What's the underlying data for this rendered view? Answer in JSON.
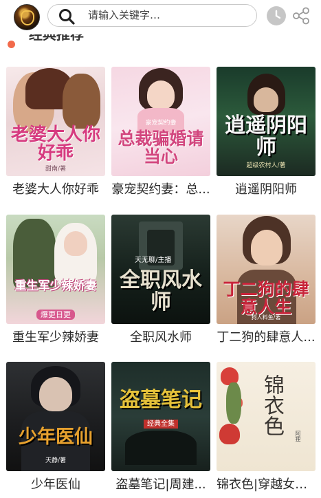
{
  "header": {
    "search_placeholder": "请输入关键字…"
  },
  "section": {
    "title": "经典推荐"
  },
  "books": [
    {
      "name": "老婆大人你好乖",
      "cover_text": "老婆大人你好乖",
      "cover_sub": "甜南/著"
    },
    {
      "name": "豪宠契约妻：总...",
      "cover_text": "总裁骗婚请当心",
      "cover_sub": "豪宠契约妻"
    },
    {
      "name": "逍遥阴阳师",
      "cover_text": "逍遥阴阳师",
      "cover_sub": "超级农村人/著"
    },
    {
      "name": "重生军少辣娇妻",
      "cover_text": "重生军少辣娇妻",
      "cover_sub": "爆更日更"
    },
    {
      "name": "全职风水师",
      "cover_text": "全职风水师",
      "cover_sub": "天无聊/主播"
    },
    {
      "name": "丁二狗的肆意人...",
      "cover_text": "丁二狗的肆意人生",
      "cover_sub": "狗人料鱼/著"
    },
    {
      "name": "少年医仙",
      "cover_text": "少年医仙",
      "cover_sub": "天静/著"
    },
    {
      "name": "盗墓笔记|周建...",
      "cover_text": "盗墓笔记",
      "cover_sub": "经典全集"
    },
    {
      "name": "锦衣色|穿越女&...",
      "cover_text": "锦衣色",
      "cover_sub": "阿狸"
    }
  ]
}
